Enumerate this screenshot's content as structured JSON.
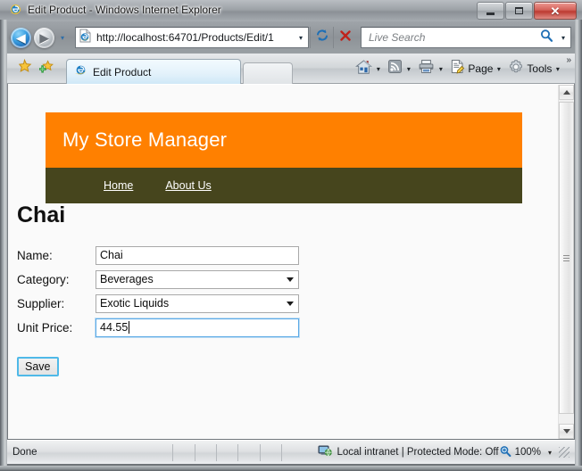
{
  "window": {
    "title": "Edit Product - Windows Internet Explorer",
    "minimize_label": "Minimize",
    "maximize_label": "Maximize",
    "close_label": "✕"
  },
  "address_bar": {
    "back_label": "◀",
    "forward_label": "▶",
    "history_caret": "▾",
    "url": "http://localhost:64701/Products/Edit/1",
    "url_caret": "▾",
    "refresh_label": "Refresh",
    "stop_label": "Stop",
    "search_placeholder": "Live Search",
    "search_value": "",
    "search_caret": "▾"
  },
  "tabs": {
    "favorites_label": "Favorites Center",
    "add_favorite_label": "Add to Favorites",
    "items": [
      {
        "label": "Edit Product",
        "active": true
      }
    ],
    "new_tab_label": ""
  },
  "command_bar": {
    "home_label": "Home",
    "home_caret": "▾",
    "feeds_label": "Feeds",
    "feeds_caret": "▾",
    "print_label": "Print",
    "print_caret": "▾",
    "page_label": "Page",
    "page_caret": "▾",
    "tools_label": "Tools",
    "tools_caret": "▾",
    "overflow_label": "»"
  },
  "page": {
    "site_title": "My Store Manager",
    "nav": [
      {
        "label": "Home"
      },
      {
        "label": "About Us"
      }
    ],
    "heading": "Chai",
    "form": {
      "fields": [
        {
          "label": "Name:",
          "type": "text",
          "value": "Chai",
          "focused": false
        },
        {
          "label": "Category:",
          "type": "select",
          "value": "Beverages",
          "focused": false
        },
        {
          "label": "Supplier:",
          "type": "select",
          "value": "Exotic Liquids",
          "focused": false
        },
        {
          "label": "Unit Price:",
          "type": "text",
          "value": "44.55",
          "focused": true
        }
      ],
      "submit_label": "Save"
    },
    "colors": {
      "banner": "#ff8000",
      "nav": "#46451d",
      "page_background": "#fafafa",
      "focus_border": "#5aa9e6"
    }
  },
  "scrollbar": {
    "up_label": "▲",
    "down_label": "▼"
  },
  "status_bar": {
    "status": "Done",
    "zone": "Local intranet | Protected Mode: Off",
    "zoom": "100%",
    "zoom_caret": "▾"
  }
}
